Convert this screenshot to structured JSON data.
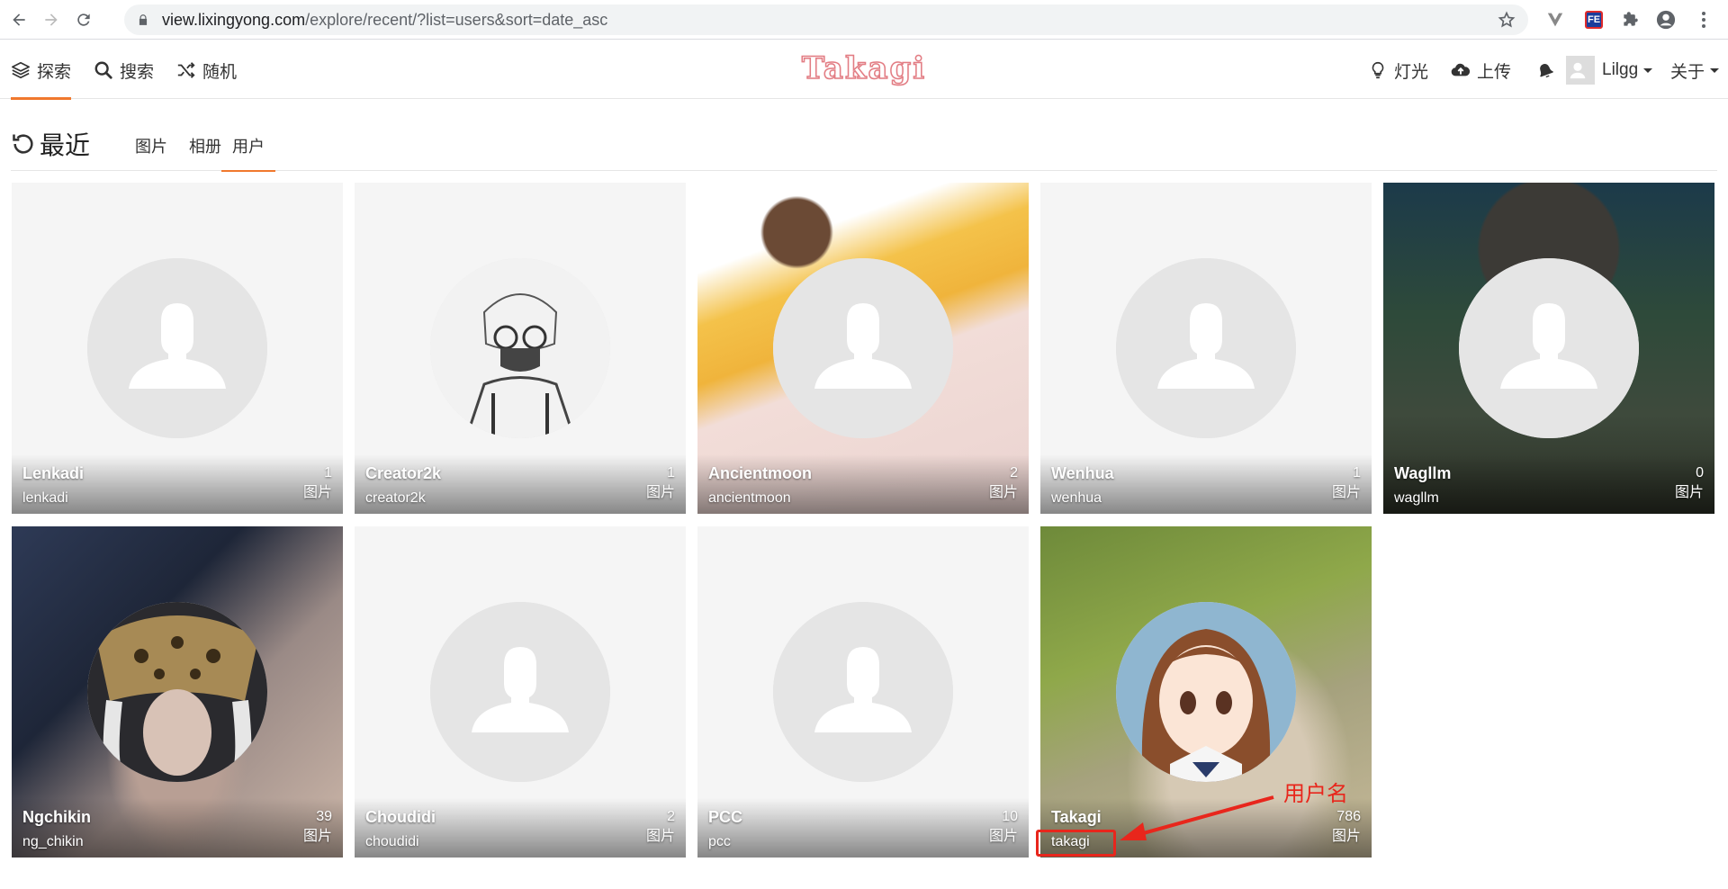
{
  "browser": {
    "url_host": "view.lixingyong.com",
    "url_path": "/explore/recent/?list=users&sort=date_asc"
  },
  "header": {
    "explore_label": "探索",
    "search_label": "搜索",
    "random_label": "随机",
    "logo_text": "Takagi",
    "light_label": "灯光",
    "upload_label": "上传",
    "user_label": "Lilgg",
    "about_label": "关于"
  },
  "subnav": {
    "title": "最近",
    "tabs": [
      "图片",
      "相册",
      "用户"
    ],
    "active_tab": "用户"
  },
  "count_label": "图片",
  "users": [
    {
      "display_name": "Lenkadi",
      "username": "lenkadi",
      "count": "1",
      "has_photo": false,
      "cover": "blank"
    },
    {
      "display_name": "Creator2k",
      "username": "creator2k",
      "count": "1",
      "has_photo": true,
      "cover": "blank",
      "avatar_icon": "sketch-boy-avatar-icon"
    },
    {
      "display_name": "Ancientmoon",
      "username": "ancientmoon",
      "count": "2",
      "has_photo": false,
      "cover": "anime-girl-yellow"
    },
    {
      "display_name": "Wenhua",
      "username": "wenhua",
      "count": "1",
      "has_photo": false,
      "cover": "blank"
    },
    {
      "display_name": "Wagllm",
      "username": "wagllm",
      "count": "0",
      "has_photo": false,
      "cover": "dark-forest-ninja"
    },
    {
      "display_name": "Ngchikin",
      "username": "ng_chikin",
      "count": "39",
      "has_photo": true,
      "cover": "dark-haired-figure",
      "avatar_icon": "golden-mask-avatar-icon"
    },
    {
      "display_name": "Choudidi",
      "username": "choudidi",
      "count": "2",
      "has_photo": false,
      "cover": "blank"
    },
    {
      "display_name": "PCC",
      "username": "pcc",
      "count": "10",
      "has_photo": false,
      "cover": "blank"
    },
    {
      "display_name": "Takagi",
      "username": "takagi",
      "count": "786",
      "has_photo": true,
      "cover": "kitten-green",
      "avatar_icon": "anime-girl-takagi-avatar-icon"
    }
  ],
  "annotation": {
    "label": "用户名",
    "color": "#e8261c"
  },
  "colors": {
    "accent": "#f0782d",
    "placeholder_circle": "#e5e5e5",
    "card_bg": "#f5f5f5"
  }
}
